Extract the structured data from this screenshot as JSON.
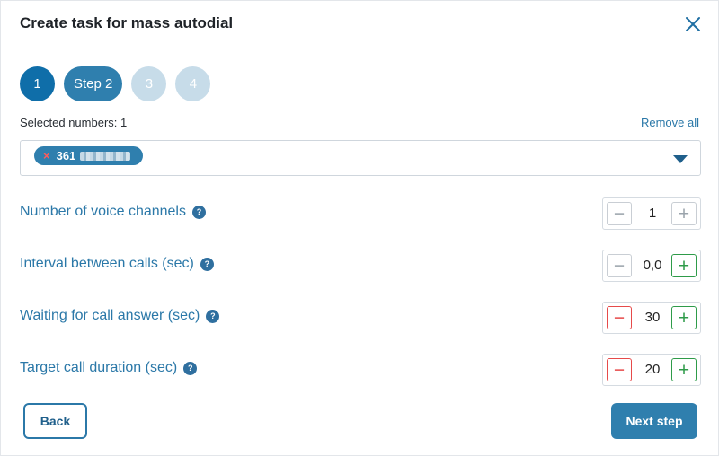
{
  "dialog": {
    "title": "Create task for mass autodial"
  },
  "steps": [
    {
      "label": "1",
      "state": "done"
    },
    {
      "label": "Step 2",
      "state": "current"
    },
    {
      "label": "3",
      "state": "pending"
    },
    {
      "label": "4",
      "state": "pending"
    }
  ],
  "numbers": {
    "selected_label": "Selected numbers: 1",
    "remove_all": "Remove all",
    "chip_prefix": "361"
  },
  "settings": [
    {
      "label": "Number of voice channels",
      "value": "1"
    },
    {
      "label": "Interval between calls (sec)",
      "value": "0,0"
    },
    {
      "label": "Waiting for call answer (sec)",
      "value": "30"
    },
    {
      "label": "Target call duration (sec)",
      "value": "20"
    }
  ],
  "icons": {
    "help": "?",
    "remove_chip": "×",
    "minus": "−",
    "plus": "+"
  },
  "footer": {
    "back": "Back",
    "next": "Next step"
  },
  "colors": {
    "accent": "#2f7fae",
    "link": "#2b78a8",
    "minus_active": "#e64a4a",
    "plus_active": "#2e9b49"
  }
}
